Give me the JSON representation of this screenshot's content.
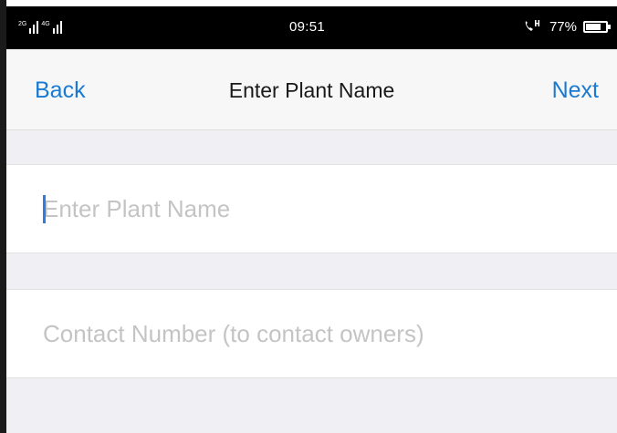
{
  "status_bar": {
    "signal_1_tag": "2G",
    "signal_2_tag": "4G",
    "time": "09:51",
    "battery_percent": "77%",
    "battery_level": 0.77
  },
  "nav": {
    "back_label": "Back",
    "title": "Enter Plant Name",
    "next_label": "Next"
  },
  "form": {
    "plant_name": {
      "value": "",
      "placeholder": "Enter Plant Name"
    },
    "contact_number": {
      "value": "",
      "placeholder": "Contact Number (to contact owners)"
    }
  },
  "colors": {
    "accent": "#1a7ad1",
    "caret": "#2f7de1",
    "background": "#efeff4",
    "nav_background": "#f7f7f7",
    "placeholder": "#c4c4c4"
  },
  "icons": {
    "signal": "signal-bars-icon",
    "hd_call": "hd-call-icon",
    "battery": "battery-icon"
  }
}
